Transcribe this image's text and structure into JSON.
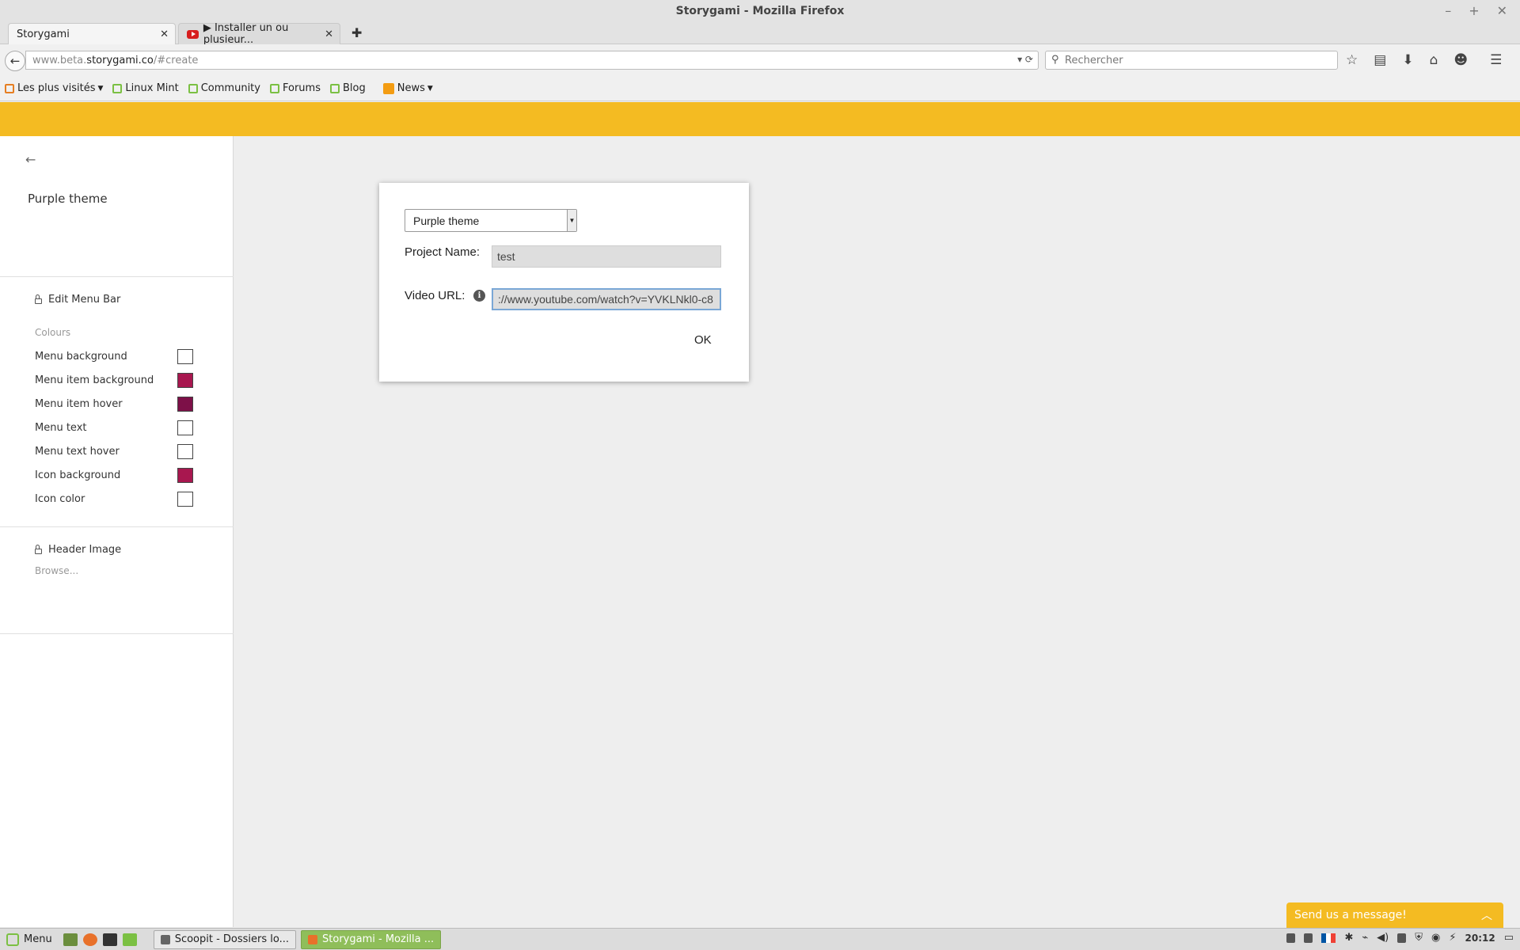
{
  "window": {
    "title": "Storygami - Mozilla Firefox",
    "controls": [
      "–",
      "+",
      "✕"
    ]
  },
  "tabs": [
    {
      "label": "Storygami",
      "active": true
    },
    {
      "label": "▶ Installer un ou plusieur...",
      "active": false
    }
  ],
  "navbar": {
    "url_prefix": "www.beta.",
    "url_host": "storygami.co",
    "url_path": "/#create",
    "search_placeholder": "Rechercher"
  },
  "bookmarks": [
    {
      "label": "Les plus visités"
    },
    {
      "label": "Linux Mint"
    },
    {
      "label": "Community"
    },
    {
      "label": "Forums"
    },
    {
      "label": "Blog"
    },
    {
      "label": "News"
    }
  ],
  "sidebar": {
    "theme_name": "Purple theme",
    "edit_menu_bar": "Edit Menu Bar",
    "colours_label": "Colours",
    "colours": [
      {
        "label": "Menu background",
        "color": "#ffffff"
      },
      {
        "label": "Menu item background",
        "color": "#a8174f"
      },
      {
        "label": "Menu item hover",
        "color": "#7d1048"
      },
      {
        "label": "Menu text",
        "color": "#ffffff"
      },
      {
        "label": "Menu text hover",
        "color": "#ffffff"
      },
      {
        "label": "Icon background",
        "color": "#a8174f"
      },
      {
        "label": "Icon color",
        "color": "#ffffff"
      }
    ],
    "header_image": "Header Image",
    "browse": "Browse..."
  },
  "dialog": {
    "theme_select": "Purple theme",
    "project_name_label": "Project Name:",
    "project_name_value": "test",
    "video_url_label": "Video URL:",
    "video_url_value": "://www.youtube.com/watch?v=YVKLNkl0-c8",
    "ok_label": "OK"
  },
  "message_widget": {
    "label": "Send us a message!"
  },
  "taskbar": {
    "menu_label": "Menu",
    "tasks": [
      {
        "label": "Scoopit - Dossiers lo...",
        "active": false
      },
      {
        "label": "Storygami - Mozilla ...",
        "active": true
      }
    ],
    "clock": "20:12"
  },
  "colors": {
    "accent_yellow": "#f4bb22",
    "taskbar_active": "#8fbe5a"
  }
}
